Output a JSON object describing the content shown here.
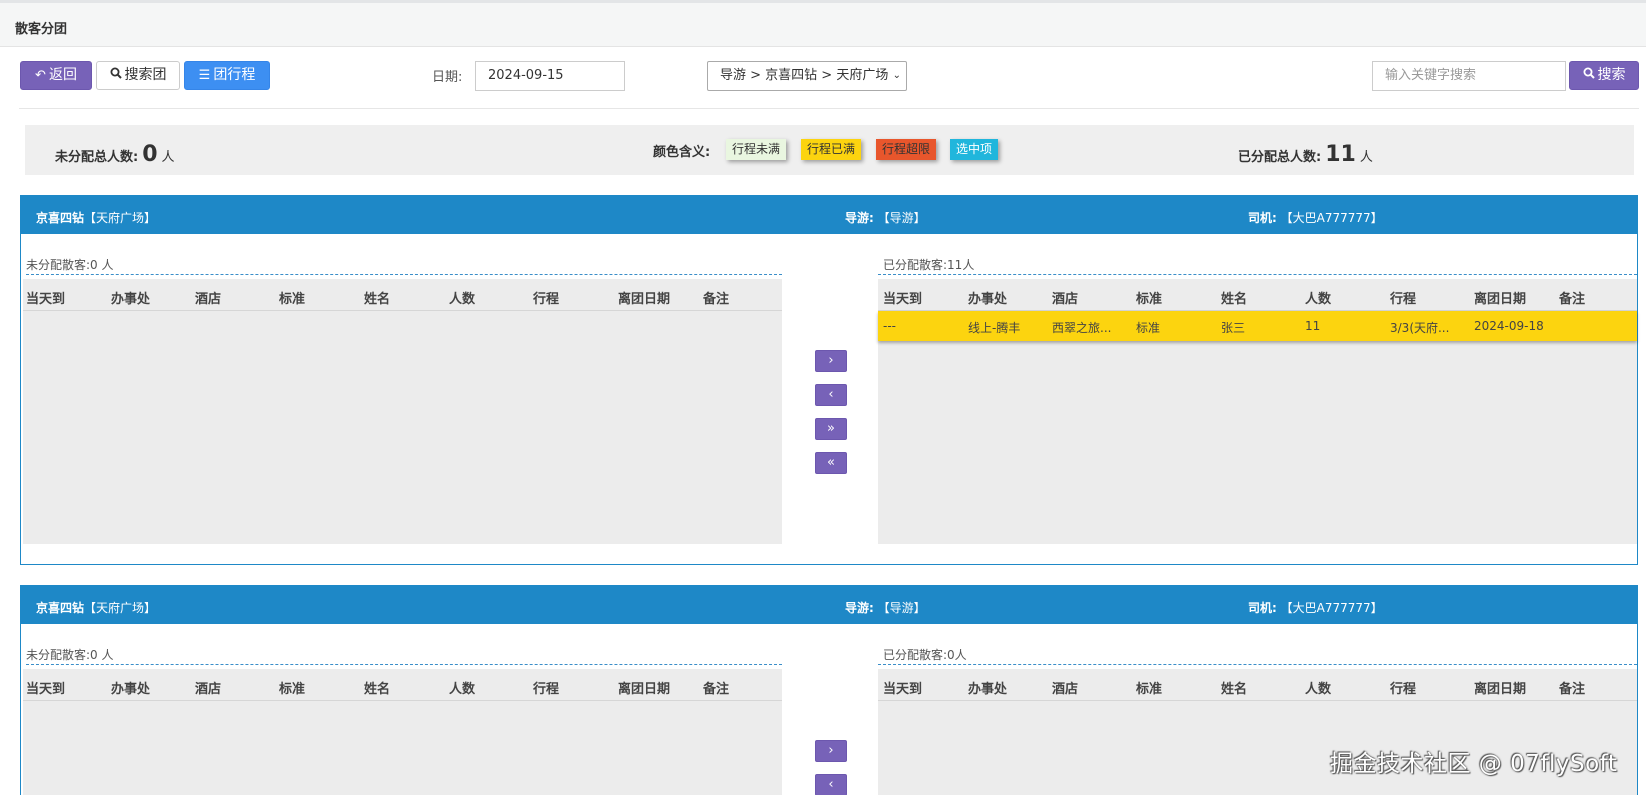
{
  "page": {
    "title": "散客分团"
  },
  "toolbar": {
    "back_label": "返回",
    "search_group_label": "搜索团",
    "group_itinerary_label": "团行程",
    "date_label": "日期:",
    "date_value": "2024-09-15",
    "route_select": "导游 > 京喜四钻 > 天府广场",
    "search_placeholder": "输入关键字搜索",
    "search_button": "搜索"
  },
  "summary": {
    "unassigned_label": "未分配总人数:",
    "unassigned_count": "0",
    "unit": "人",
    "legend_label": "颜色含义:",
    "legend": [
      {
        "label": "行程未满",
        "color": "#e9f6e0"
      },
      {
        "label": "行程已满",
        "color": "#fcd40f"
      },
      {
        "label": "行程超限",
        "color": "#e8562c"
      },
      {
        "label": "选中项",
        "color": "#20b6dc"
      }
    ],
    "assigned_label": "已分配总人数:",
    "assigned_count": "11"
  },
  "columns": [
    "当天到",
    "办事处",
    "酒店",
    "标准",
    "姓名",
    "人数",
    "行程",
    "离团日期",
    "备注"
  ],
  "panels": [
    {
      "name": "京喜四钻",
      "location": "【天府广场】",
      "guide_label": "导游:",
      "guide": "【导游】",
      "driver_label": "司机:",
      "driver": "【大巴A777777】",
      "left_title": "未分配散客:0 人",
      "right_title": "已分配散客:11人",
      "right_rows": [
        [
          "---",
          "线上-腾丰",
          "西翠之旅...",
          "标准",
          "张三",
          "11",
          "3/3(天府...",
          "2024-09-18",
          ""
        ]
      ]
    },
    {
      "name": "京喜四钻",
      "location": "【天府广场】",
      "guide_label": "导游:",
      "guide": "【导游】",
      "driver_label": "司机:",
      "driver": "【大巴A777777】",
      "left_title": "未分配散客:0 人",
      "right_title": "已分配散客:0人",
      "right_rows": []
    }
  ],
  "move_buttons": [
    "›",
    "‹",
    "»",
    "«"
  ],
  "watermark": "掘金技术社区 @ 07flySoft"
}
